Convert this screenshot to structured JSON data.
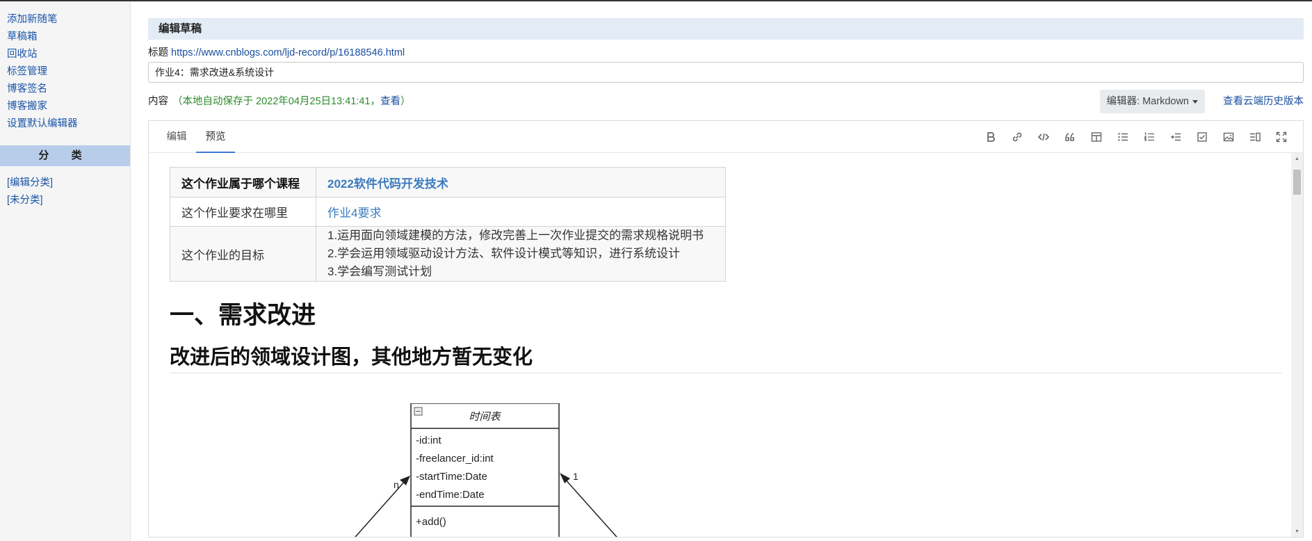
{
  "sidebar": {
    "nav": [
      "添加新随笔",
      "草稿箱",
      "回收站",
      "标签管理",
      "博客签名",
      "博客搬家",
      "设置默认编辑器"
    ],
    "category_heading": "分 类",
    "categories": [
      "[编辑分类]",
      "[未分类]"
    ]
  },
  "header": {
    "section_title": "编辑草稿",
    "title_label": "标题",
    "title_url": "https://www.cnblogs.com/ljd-record/p/16188546.html",
    "title_value": "作业4：需求改进&系统设计"
  },
  "content": {
    "label": "内容",
    "autosave_prefix": "（本地自动保存于 2022年04月25日13:41:41，",
    "autosave_view": "查看",
    "autosave_suffix": "）",
    "editor_select": "编辑器: Markdown",
    "history_link": "查看云端历史版本"
  },
  "editor": {
    "tabs": [
      "编辑",
      "预览"
    ],
    "active_tab": "预览",
    "toolbar": [
      "bold-icon",
      "link-icon",
      "code-icon",
      "quote-icon",
      "table-icon",
      "unordered-list-icon",
      "ordered-list-icon",
      "indent-icon",
      "checkbox-icon",
      "image-icon",
      "split-view-icon",
      "fullscreen-icon"
    ]
  },
  "preview": {
    "table": {
      "rows": [
        {
          "label": "这个作业属于哪个课程",
          "value": "2022软件代码开发技术"
        },
        {
          "label": "这个作业要求在哪里",
          "value": "作业4要求"
        },
        {
          "label": "这个作业的目标",
          "lines": [
            "1.运用面向领域建模的方法，修改完善上一次作业提交的需求规格说明书",
            "2.学会运用领域驱动设计方法、软件设计模式等知识，进行系统设计",
            "3.学会编写测试计划"
          ]
        }
      ]
    },
    "h1": "一、需求改进",
    "h2": "改进后的领域设计图，其他地方暂无变化",
    "diagram": {
      "class_name": "时间表",
      "attributes": [
        "-id:int",
        "-freelancer_id:int",
        "-startTime:Date",
        "-endTime:Date"
      ],
      "methods": [
        "+add()"
      ],
      "left_multiplicity": "n",
      "right_multiplicity": "1",
      "collapse_symbol": "−"
    }
  },
  "colors": {
    "accent": "#3a7bd5",
    "link": "#1a4fa0",
    "autosave": "#2e8b2e",
    "category_header": "#b8cde9",
    "section_header": "#e3ebf5"
  }
}
